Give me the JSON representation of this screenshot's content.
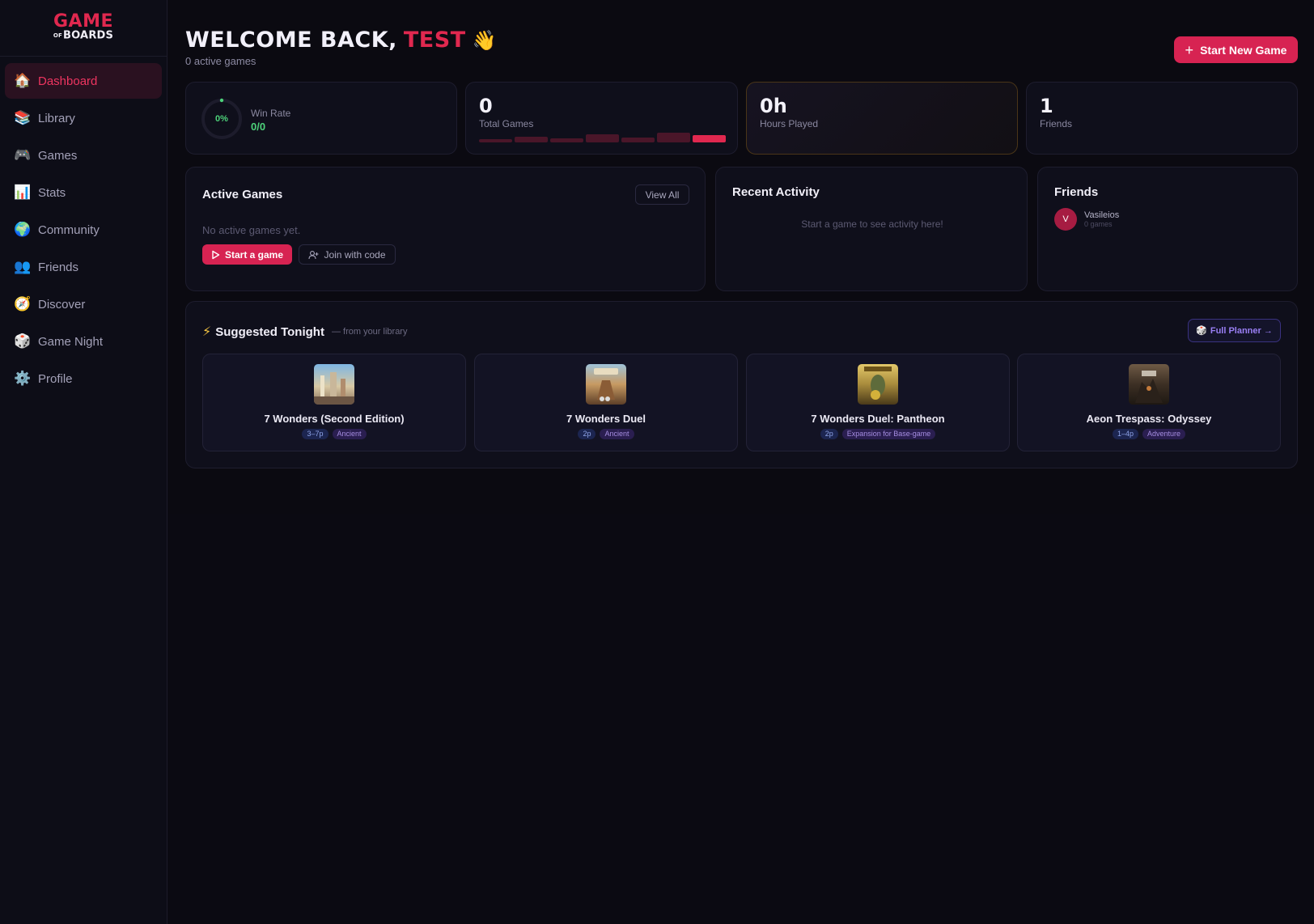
{
  "app": {
    "logo_top": "GAME",
    "logo_small": "OF",
    "logo_bottom": "BOARDS"
  },
  "sidebar": {
    "items": [
      {
        "label": "Dashboard",
        "icon": "house-icon",
        "glyph": "🏠",
        "active": true
      },
      {
        "label": "Library",
        "icon": "books-icon",
        "glyph": "📚"
      },
      {
        "label": "Games",
        "icon": "gamepad-icon",
        "glyph": "🎮"
      },
      {
        "label": "Stats",
        "icon": "bar-chart-icon",
        "glyph": "📊"
      },
      {
        "label": "Community",
        "icon": "globe-icon",
        "glyph": "🌍"
      },
      {
        "label": "Friends",
        "icon": "people-icon",
        "glyph": "👥"
      },
      {
        "label": "Discover",
        "icon": "compass-icon",
        "glyph": "🧭"
      },
      {
        "label": "Game Night",
        "icon": "dice-icon",
        "glyph": "🎲"
      },
      {
        "label": "Profile",
        "icon": "gear-icon",
        "glyph": "⚙️"
      }
    ]
  },
  "header": {
    "welcome": "WELCOME BACK,",
    "name": "TEST",
    "wave": "👋",
    "subtitle": "0 active games",
    "start_button": "Start New Game"
  },
  "stats": {
    "win_rate_percent": "0%",
    "win_rate_label": "Win Rate",
    "win_rate_value": "0/0",
    "total_games": "0",
    "total_games_label": "Total Games",
    "hours": "0h",
    "hours_label": "Hours Played",
    "friends": "1",
    "friends_label": "Friends"
  },
  "active_games": {
    "title": "Active Games",
    "view_all": "View All",
    "empty": "No active games yet.",
    "start_button": "Start a game",
    "join_button": "Join with code"
  },
  "recent_activity": {
    "title": "Recent Activity",
    "empty": "Start a game to see activity here!"
  },
  "friends_panel": {
    "title": "Friends",
    "list": [
      {
        "initial": "V",
        "name": "Vasileios",
        "meta": "0 games"
      }
    ]
  },
  "suggested": {
    "icon": "⚡",
    "title": "Suggested Tonight",
    "subtitle": "— from your library",
    "planner_button": "Full Planner →",
    "games": [
      {
        "title": "7 Wonders (Second Edition)",
        "players": "3–7p",
        "genre": "Ancient"
      },
      {
        "title": "7 Wonders Duel",
        "players": "2p",
        "genre": "Ancient"
      },
      {
        "title": "7 Wonders Duel: Pantheon",
        "players": "2p",
        "genre": "Expansion for Base-game"
      },
      {
        "title": "Aeon Trespass: Odyssey",
        "players": "1–4p",
        "genre": "Adventure"
      }
    ]
  },
  "colors": {
    "accent": "#d72352",
    "success": "#4dd27a",
    "planner": "#8b6cf0"
  }
}
